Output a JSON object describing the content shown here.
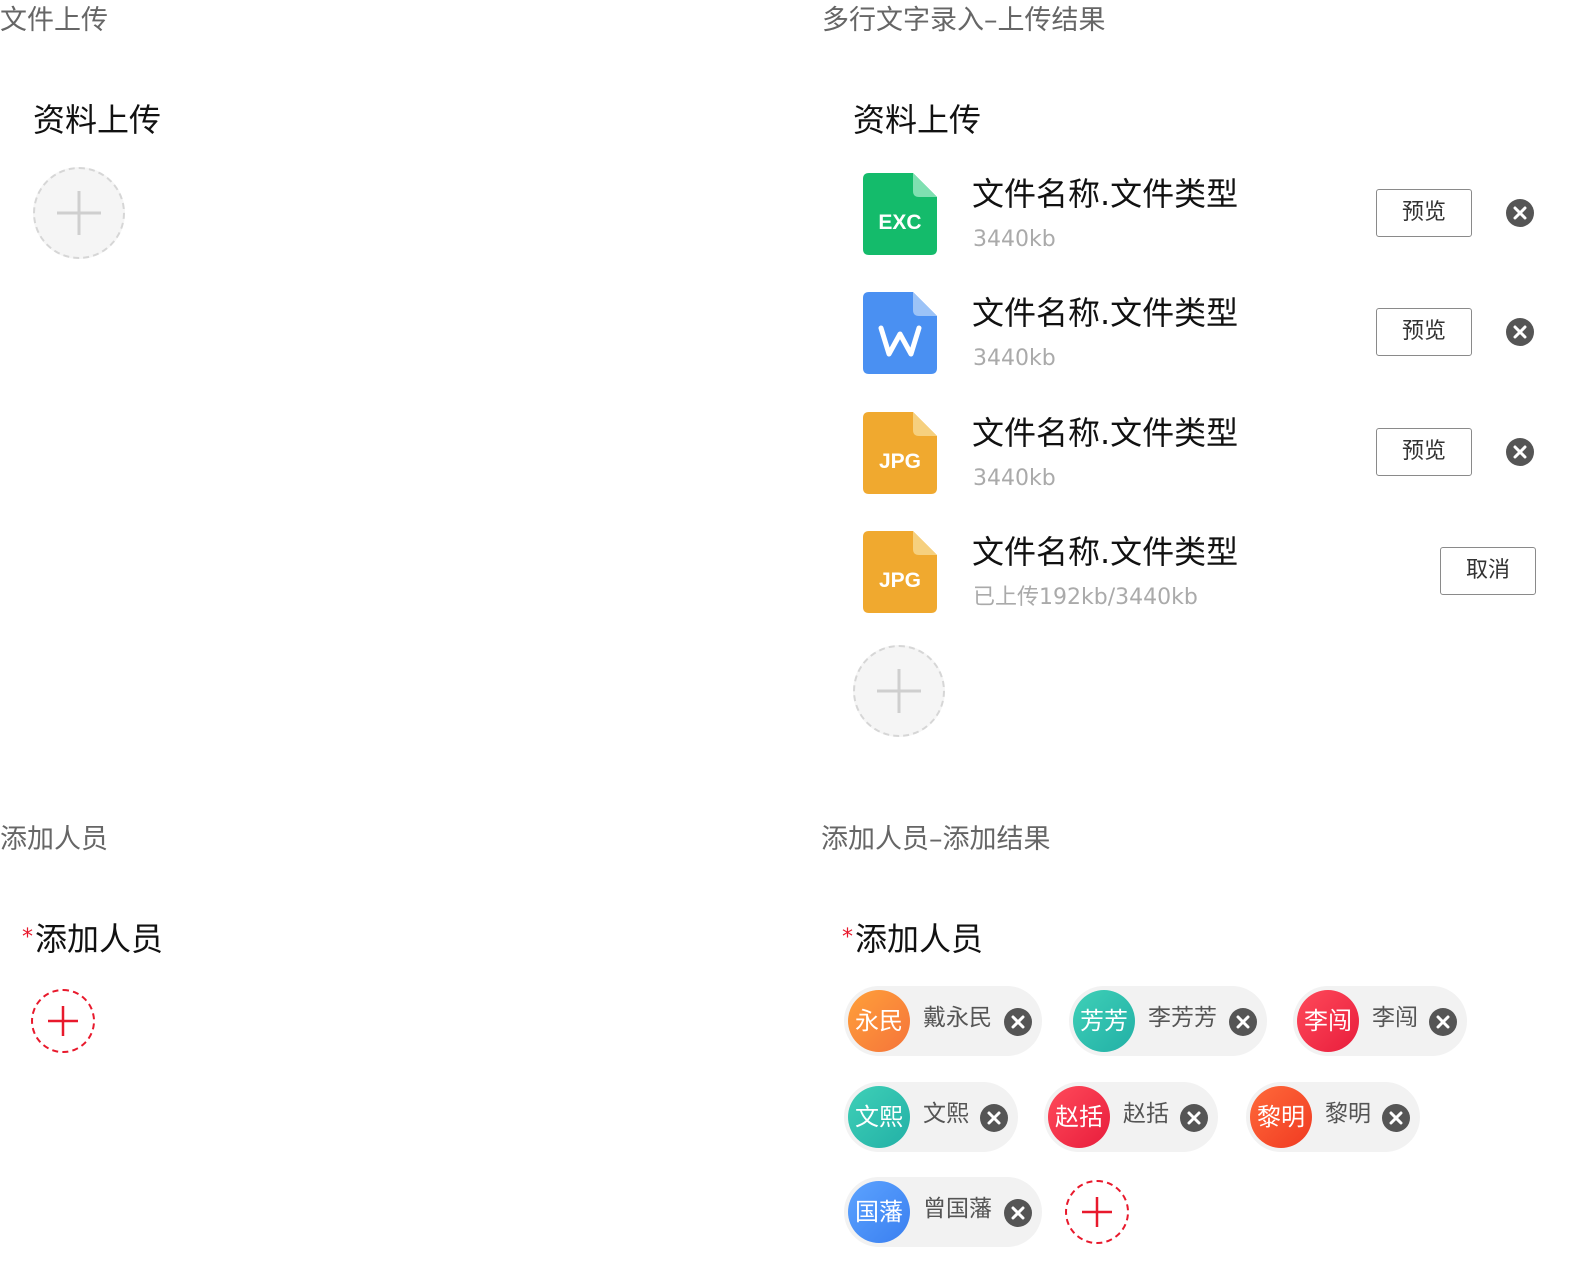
{
  "sections": {
    "file_upload": {
      "title": "文件上传",
      "field_label": "资料上传"
    },
    "file_upload_result": {
      "title": "多行文字录入–上传结果",
      "field_label": "资料上传",
      "files": [
        {
          "type": "EXC",
          "color": "#14bb6b",
          "fold": "#7fe0b1",
          "name": "文件名称.文件类型",
          "size": "3440kb",
          "action": "预览",
          "icon": "excel-file-icon"
        },
        {
          "type": "W",
          "color": "#4a90f2",
          "fold": "#9cc3f7",
          "name": "文件名称.文件类型",
          "size": "3440kb",
          "action": "预览",
          "icon": "word-file-icon"
        },
        {
          "type": "JPG",
          "color": "#f0a92f",
          "fold": "#f6d07e",
          "name": "文件名称.文件类型",
          "size": "3440kb",
          "action": "预览",
          "icon": "image-file-icon"
        },
        {
          "type": "JPG",
          "color": "#f0a92f",
          "fold": "#f6d07e",
          "name": "文件名称.文件类型",
          "size": "已上传192kb/3440kb",
          "action": "取消",
          "icon": "image-file-icon"
        }
      ]
    },
    "add_people": {
      "title": "添加人员",
      "required_mark": "*",
      "field_label": "添加人员"
    },
    "add_people_result": {
      "title": "添加人员–添加结果",
      "required_mark": "*",
      "field_label": "添加人员",
      "people": [
        {
          "avatar_text": "永民",
          "name": "戴永民",
          "color_from": "#ffa03a",
          "color_to": "#f5743a"
        },
        {
          "avatar_text": "芳芳",
          "name": "李芳芳",
          "color_from": "#3fd0b7",
          "color_to": "#22b0a6"
        },
        {
          "avatar_text": "李闯",
          "name": "李闯",
          "color_from": "#ff4a5a",
          "color_to": "#e81d3c"
        },
        {
          "avatar_text": "文熙",
          "name": "文熙",
          "color_from": "#3fd0b7",
          "color_to": "#22b0a6"
        },
        {
          "avatar_text": "赵括",
          "name": "赵括",
          "color_from": "#ff4a5a",
          "color_to": "#e81d3c"
        },
        {
          "avatar_text": "黎明",
          "name": "黎明",
          "color_from": "#ff6a3a",
          "color_to": "#f03a22"
        },
        {
          "avatar_text": "国藩",
          "name": "曾国藩",
          "color_from": "#5ca3ff",
          "color_to": "#3a7ff0"
        }
      ]
    }
  },
  "colors": {
    "required": "#e8192c",
    "add_border_gray": "#d6d6d6",
    "add_bg_gray": "#f5f5f5",
    "chip_bg": "#f2f2f2",
    "close_icon": "#555555"
  }
}
